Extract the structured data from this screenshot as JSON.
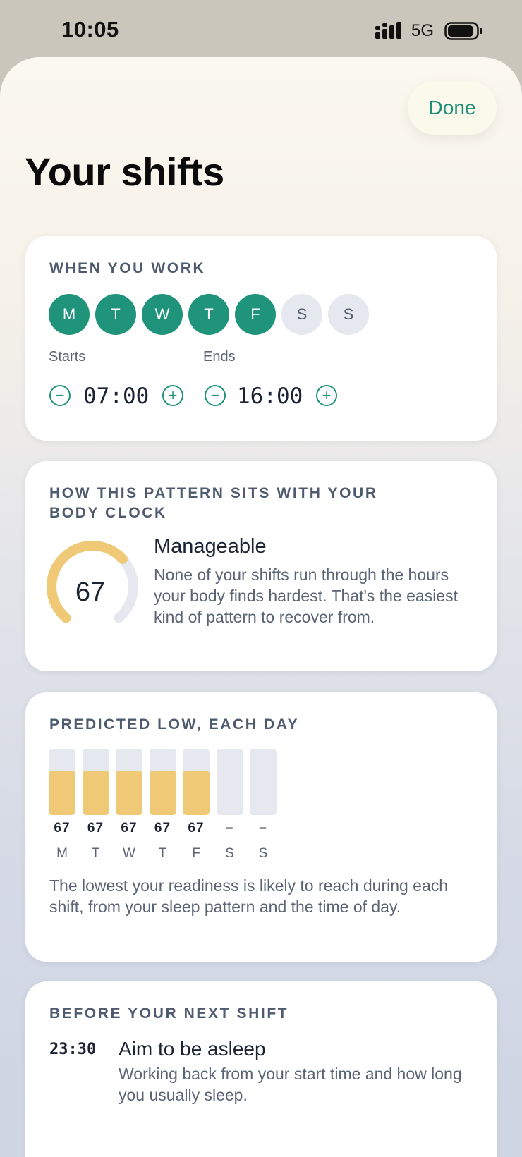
{
  "status_bar": {
    "time": "10:05",
    "network": "5G"
  },
  "header": {
    "done_label": "Done",
    "title": "Your shifts"
  },
  "when_you_work": {
    "heading": "WHEN YOU WORK",
    "days": [
      {
        "label": "M",
        "on": true
      },
      {
        "label": "T",
        "on": true
      },
      {
        "label": "W",
        "on": true
      },
      {
        "label": "T",
        "on": true
      },
      {
        "label": "F",
        "on": true
      },
      {
        "label": "S",
        "on": false
      },
      {
        "label": "S",
        "on": false
      }
    ],
    "starts_label": "Starts",
    "start_time": "07:00",
    "ends_label": "Ends",
    "end_time": "16:00"
  },
  "body_clock": {
    "heading": "HOW THIS PATTERN SITS WITH YOUR BODY CLOCK",
    "score": "67",
    "score_max": 100,
    "rating": "Manageable",
    "description": "None of your shifts run through the hours your body finds hardest. That's the easiest kind of pattern to recover from.",
    "accent_color": "#f0c976",
    "track_color": "#e5e8ef"
  },
  "predicted_low": {
    "heading": "PREDICTED LOW, EACH DAY",
    "days": [
      "M",
      "T",
      "W",
      "T",
      "F",
      "S",
      "S"
    ],
    "values": [
      67,
      67,
      67,
      67,
      67,
      null,
      null
    ],
    "value_labels": [
      "67",
      "67",
      "67",
      "67",
      "67",
      "–",
      "–"
    ],
    "max": 100,
    "caption": "The lowest your readiness is likely to reach during each shift, from your sleep pattern and the time of day."
  },
  "next_shift": {
    "heading": "BEFORE YOUR NEXT SHIFT",
    "items": [
      {
        "time": "23:30",
        "title": "Aim to be asleep",
        "description": "Working back from your start time and how long you usually sleep."
      }
    ]
  },
  "colors": {
    "accent_green": "#1f947a",
    "bar_fill": "#f0c976"
  }
}
